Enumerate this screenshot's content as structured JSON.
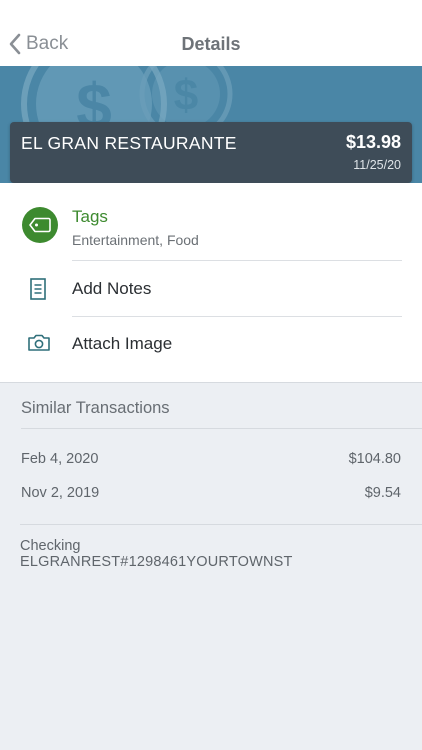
{
  "nav": {
    "back_label": "Back",
    "title": "Details"
  },
  "merchant": {
    "name": "EL GRAN RESTAURANTE",
    "amount": "$13.98",
    "date": "11/25/20"
  },
  "tags": {
    "label": "Tags",
    "values": "Entertainment, Food",
    "icon": "tag-icon"
  },
  "actions": [
    {
      "label": "Add Notes",
      "icon": "notes-icon"
    },
    {
      "label": "Attach Image",
      "icon": "camera-icon"
    }
  ],
  "similar": {
    "title": "Similar Transactions",
    "transactions": [
      {
        "date": "Feb 4, 2020",
        "amount": "$104.80"
      },
      {
        "date": "Nov 2, 2019",
        "amount": "$9.54"
      }
    ]
  },
  "account": {
    "name": "Checking",
    "description": "ELGRANREST#1298461YOURTOWNST"
  },
  "colors": {
    "accent_green": "#3d8a2f",
    "hero_blue": "#4a86a6",
    "card_dark": "#3e4c58",
    "icon_teal": "#2f6f7a"
  }
}
